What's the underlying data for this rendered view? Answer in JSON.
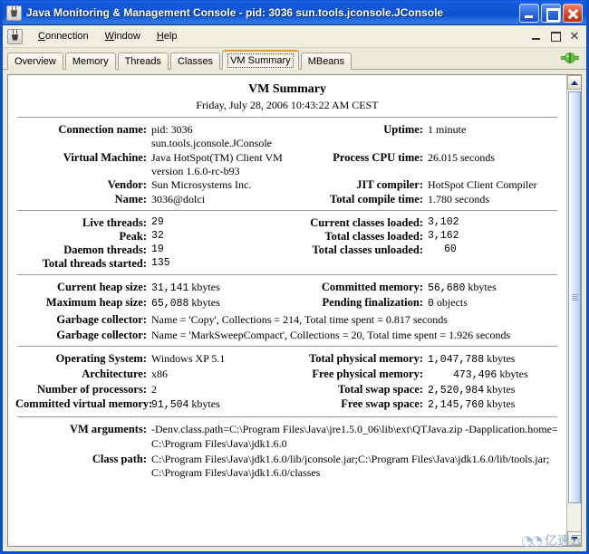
{
  "window": {
    "title": "Java Monitoring & Management Console - pid: 3036 sun.tools.jconsole.JConsole",
    "minimize_label": "Minimize",
    "maximize_label": "Maximize",
    "close_label": "Close"
  },
  "menubar": {
    "items": [
      {
        "label": "Connection",
        "mnemonic": "C"
      },
      {
        "label": "Window",
        "mnemonic": "W"
      },
      {
        "label": "Help",
        "mnemonic": "H"
      }
    ],
    "window_buttons": {
      "minimize": "_",
      "restore": "❐",
      "close": "✕"
    }
  },
  "tabs": {
    "items": [
      {
        "label": "Overview",
        "active": false
      },
      {
        "label": "Memory",
        "active": false
      },
      {
        "label": "Threads",
        "active": false
      },
      {
        "label": "Classes",
        "active": false
      },
      {
        "label": "VM Summary",
        "active": true
      },
      {
        "label": "MBeans",
        "active": false
      }
    ],
    "connection_indicator": "connected-green-icon"
  },
  "summary": {
    "heading": "VM Summary",
    "timestamp": "Friday, July 28, 2006 10:43:22 AM CEST",
    "section1": {
      "left": [
        {
          "label": "Connection name:",
          "value": "pid: 3036 sun.tools.jconsole.JConsole",
          "mono": false
        },
        {
          "label": "Virtual Machine:",
          "value": "Java HotSpot(TM) Client VM version 1.6.0-rc-b93",
          "mono": false
        },
        {
          "label": "Vendor:",
          "value": "Sun Microsystems Inc.",
          "mono": false
        },
        {
          "label": "Name:",
          "value": "3036@dolci",
          "mono": false
        }
      ],
      "right": [
        {
          "label": "Uptime:",
          "value": "1 minute",
          "mono": false
        },
        {
          "label": "Process CPU time:",
          "value": "26.015 seconds",
          "mono": false
        },
        {
          "label": "JIT compiler:",
          "value": "HotSpot Client Compiler",
          "mono": false
        },
        {
          "label": "Total compile time:",
          "value": "1.780 seconds",
          "mono": false
        }
      ]
    },
    "section2": {
      "left": [
        {
          "label": "Live threads:",
          "value": "29",
          "mono": true
        },
        {
          "label": "Peak:",
          "value": "32",
          "mono": true
        },
        {
          "label": "Daemon threads:",
          "value": "19",
          "mono": true
        },
        {
          "label": "Total threads started:",
          "value": "135",
          "mono": true
        }
      ],
      "right": [
        {
          "label": "Current classes loaded:",
          "value": "3,102",
          "mono": true
        },
        {
          "label": "Total classes loaded:",
          "value": "3,162",
          "mono": true
        },
        {
          "label": "Total classes unloaded:",
          "value": "60",
          "mono": true
        }
      ]
    },
    "section3": {
      "left": [
        {
          "label": "Current heap size:",
          "value": "31,141",
          "unit": "kbytes",
          "mono": true
        },
        {
          "label": "Maximum heap size:",
          "value": "65,088",
          "unit": "kbytes",
          "mono": true
        }
      ],
      "right": [
        {
          "label": "Committed memory:",
          "value": "56,680",
          "unit": "kbytes",
          "mono": true
        },
        {
          "label": "Pending finalization:",
          "value": "0",
          "unit": "objects",
          "mono": true
        }
      ],
      "wide": [
        {
          "label": "Garbage collector:",
          "value": "Name = 'Copy', Collections = 214, Total time spent = 0.817 seconds"
        },
        {
          "label": "Garbage collector:",
          "value": "Name = 'MarkSweepCompact', Collections = 20, Total time spent = 1.926 seconds"
        }
      ]
    },
    "section4": {
      "left": [
        {
          "label": "Operating System:",
          "value": "Windows XP 5.1",
          "mono": false
        },
        {
          "label": "Architecture:",
          "value": "x86",
          "mono": false
        },
        {
          "label": "Number of processors:",
          "value": "2",
          "mono": false
        },
        {
          "label": "Committed virtual memory:",
          "value": "91,504",
          "unit": "kbytes",
          "mono": true
        }
      ],
      "right": [
        {
          "label": "Total physical memory:",
          "value": "1,047,788",
          "unit": "kbytes",
          "mono": true
        },
        {
          "label": "Free physical memory:",
          "value": "473,496",
          "unit": "kbytes",
          "mono": true
        },
        {
          "label": "Total swap space:",
          "value": "2,520,984",
          "unit": "kbytes",
          "mono": true
        },
        {
          "label": "Free swap space:",
          "value": "2,145,760",
          "unit": "kbytes",
          "mono": true
        }
      ]
    },
    "section5": {
      "rows": [
        {
          "label": "VM arguments:",
          "value": "-Denv.class.path=C:\\Program Files\\Java\\jre1.5.0_06\\lib\\ext\\QTJava.zip -Dapplication.home=C:\\Program Files\\Java\\jdk1.6.0"
        },
        {
          "label": "Class path:",
          "value": "C:\\Program Files\\Java\\jdk1.6.0/lib/jconsole.jar;C:\\Program Files\\Java\\jdk1.6.0/lib/tools.jar;C:\\Program Files\\Java\\jdk1.6.0/classes"
        }
      ]
    }
  },
  "scrollbar": {
    "up_arrow": "scroll-up-icon",
    "down_arrow": "scroll-down-icon"
  },
  "watermark": {
    "logo": "◔◔",
    "text": "亿速云"
  },
  "colors": {
    "titlebar_blue": "#0f55d8",
    "frame_blue": "#0a50c8",
    "tab_active_top": "#e89b28",
    "panel_bg": "#ece9d8",
    "content_bg": "#ffffff",
    "connected_green": "#4ca832"
  }
}
